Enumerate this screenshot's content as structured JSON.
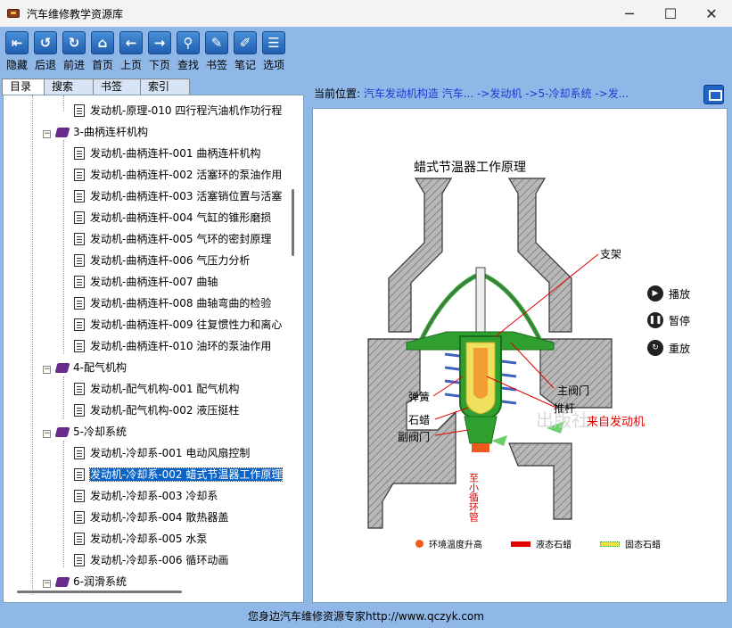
{
  "window": {
    "title": "汽车维修教学资源库"
  },
  "toolbar": {
    "buttons": [
      {
        "label": "隐藏",
        "icon": "hide-icon",
        "glyph": "⇤"
      },
      {
        "label": "后退",
        "icon": "back-circle-icon",
        "glyph": "↺"
      },
      {
        "label": "前进",
        "icon": "forward-circle-icon",
        "glyph": "↻"
      },
      {
        "label": "首页",
        "icon": "home-icon",
        "glyph": "⌂"
      },
      {
        "label": "上页",
        "icon": "left-arrow-icon",
        "glyph": "←"
      },
      {
        "label": "下页",
        "icon": "right-arrow-icon",
        "glyph": "→"
      },
      {
        "label": "查找",
        "icon": "search-icon",
        "glyph": "⚲"
      },
      {
        "label": "书签",
        "icon": "bookmark-icon",
        "glyph": "✎"
      },
      {
        "label": "笔记",
        "icon": "notes-icon",
        "glyph": "✐"
      },
      {
        "label": "选项",
        "icon": "options-icon",
        "glyph": "☰"
      }
    ]
  },
  "tabs": [
    "目录",
    "搜索",
    "书签",
    "索引"
  ],
  "tree": {
    "items": [
      {
        "type": "doc",
        "label": "发动机-原理-010 四行程汽油机作功行程"
      },
      {
        "type": "folder",
        "label": "3-曲柄连杆机构"
      },
      {
        "type": "doc",
        "label": "发动机-曲柄连杆-001 曲柄连杆机构"
      },
      {
        "type": "doc",
        "label": "发动机-曲柄连杆-002 活塞环的泵油作用"
      },
      {
        "type": "doc",
        "label": "发动机-曲柄连杆-003 活塞销位置与活塞"
      },
      {
        "type": "doc",
        "label": "发动机-曲柄连杆-004 气缸的锥形磨损"
      },
      {
        "type": "doc",
        "label": "发动机-曲柄连杆-005 气环的密封原理"
      },
      {
        "type": "doc",
        "label": "发动机-曲柄连杆-006 气压力分析"
      },
      {
        "type": "doc",
        "label": "发动机-曲柄连杆-007 曲轴"
      },
      {
        "type": "doc",
        "label": "发动机-曲柄连杆-008 曲轴弯曲的检验"
      },
      {
        "type": "doc",
        "label": "发动机-曲柄连杆-009 往复惯性力和离心"
      },
      {
        "type": "doc",
        "label": "发动机-曲柄连杆-010 油环的泵油作用"
      },
      {
        "type": "folder",
        "label": "4-配气机构"
      },
      {
        "type": "doc",
        "label": "发动机-配气机构-001 配气机构"
      },
      {
        "type": "doc",
        "label": "发动机-配气机构-002 液压挺柱"
      },
      {
        "type": "folder",
        "label": "5-冷却系统"
      },
      {
        "type": "doc",
        "label": "发动机-冷却系-001 电动风扇控制"
      },
      {
        "type": "doc-open",
        "label": "发动机-冷却系-002 蜡式节温器工作原理",
        "selected": true
      },
      {
        "type": "doc",
        "label": "发动机-冷却系-003 冷却系"
      },
      {
        "type": "doc",
        "label": "发动机-冷却系-004 散热器盖"
      },
      {
        "type": "doc",
        "label": "发动机-冷却系-005 水泵"
      },
      {
        "type": "doc",
        "label": "发动机-冷却系-006 循环动画"
      },
      {
        "type": "folder",
        "label": "6-润滑系统"
      }
    ]
  },
  "location": {
    "prefix": "当前位置:",
    "path": "汽车发动机构造 汽车... ->发动机 ->5-冷却系统 ->发..."
  },
  "diagram": {
    "title": "蜡式节温器工作原理",
    "labels": {
      "bracket": "支架",
      "spring": "弹簧",
      "main_valve": "主阀门",
      "wax": "石蜡",
      "push_rod": "推杆",
      "secondary_valve": "副阀门",
      "from_engine": "来自发动机",
      "to_small_loop": "至小循环管",
      "watermark": "出版社"
    },
    "controls": [
      {
        "label": "播放",
        "icon": "play-icon",
        "glyph": "▶"
      },
      {
        "label": "暂停",
        "icon": "pause-icon",
        "glyph": "❚❚"
      },
      {
        "label": "重放",
        "icon": "replay-icon",
        "glyph": "↻"
      }
    ],
    "legend": [
      {
        "label": "环境温度升高",
        "color": "#f05a1a"
      },
      {
        "label": "液态石蜡",
        "color": "#e00000"
      },
      {
        "label": "固态石蜡",
        "color": "#f0e040"
      }
    ],
    "colors": {
      "housing": "#808080",
      "valve_green": "#2fa02f",
      "wax_yellow": "#f0e060",
      "annotation_red": "#e00000"
    }
  },
  "statusbar": {
    "text": "您身边汽车维修资源专家http://www.qczyk.com"
  }
}
